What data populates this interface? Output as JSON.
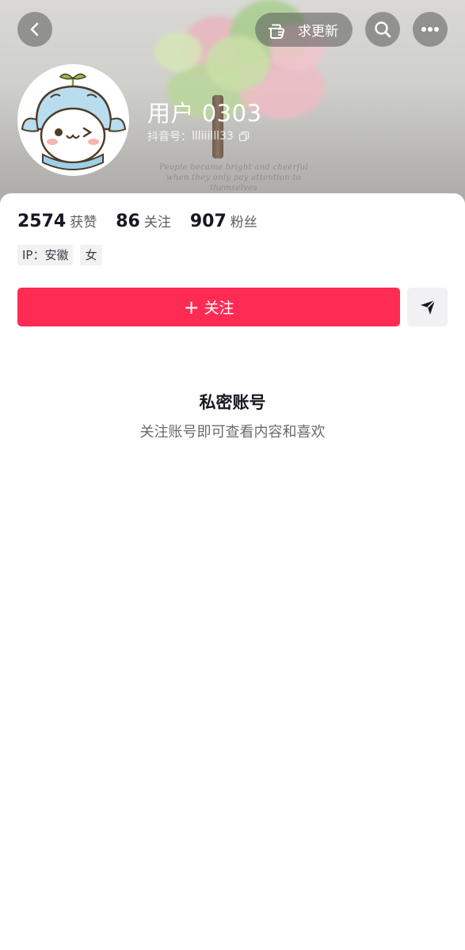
{
  "header": {
    "pill_label": "求更新",
    "banner_text": "People became bright and cheerful when they only pay attention to themselves"
  },
  "profile": {
    "username": "用户 0303",
    "id_prefix": "抖音号：",
    "id_value": "llliiilll33"
  },
  "stats": [
    {
      "value": "2574",
      "label": "获赞"
    },
    {
      "value": "86",
      "label": "关注"
    },
    {
      "value": "907",
      "label": "粉丝"
    }
  ],
  "tags": [
    {
      "label": "IP：安徽"
    },
    {
      "label": "女"
    }
  ],
  "actions": {
    "follow_plus": "+",
    "follow_label": "关注"
  },
  "private": {
    "title": "私密账号",
    "subtitle": "关注账号即可查看内容和喜欢"
  },
  "colors": {
    "accent": "#fe2c55",
    "text_primary": "#161823",
    "text_secondary": "#6a6b70"
  },
  "icons": {
    "back": "back-icon",
    "update": "pointing-hand-icon",
    "search": "search-icon",
    "more": "more-icon",
    "copy": "copy-icon",
    "share": "send-icon"
  }
}
